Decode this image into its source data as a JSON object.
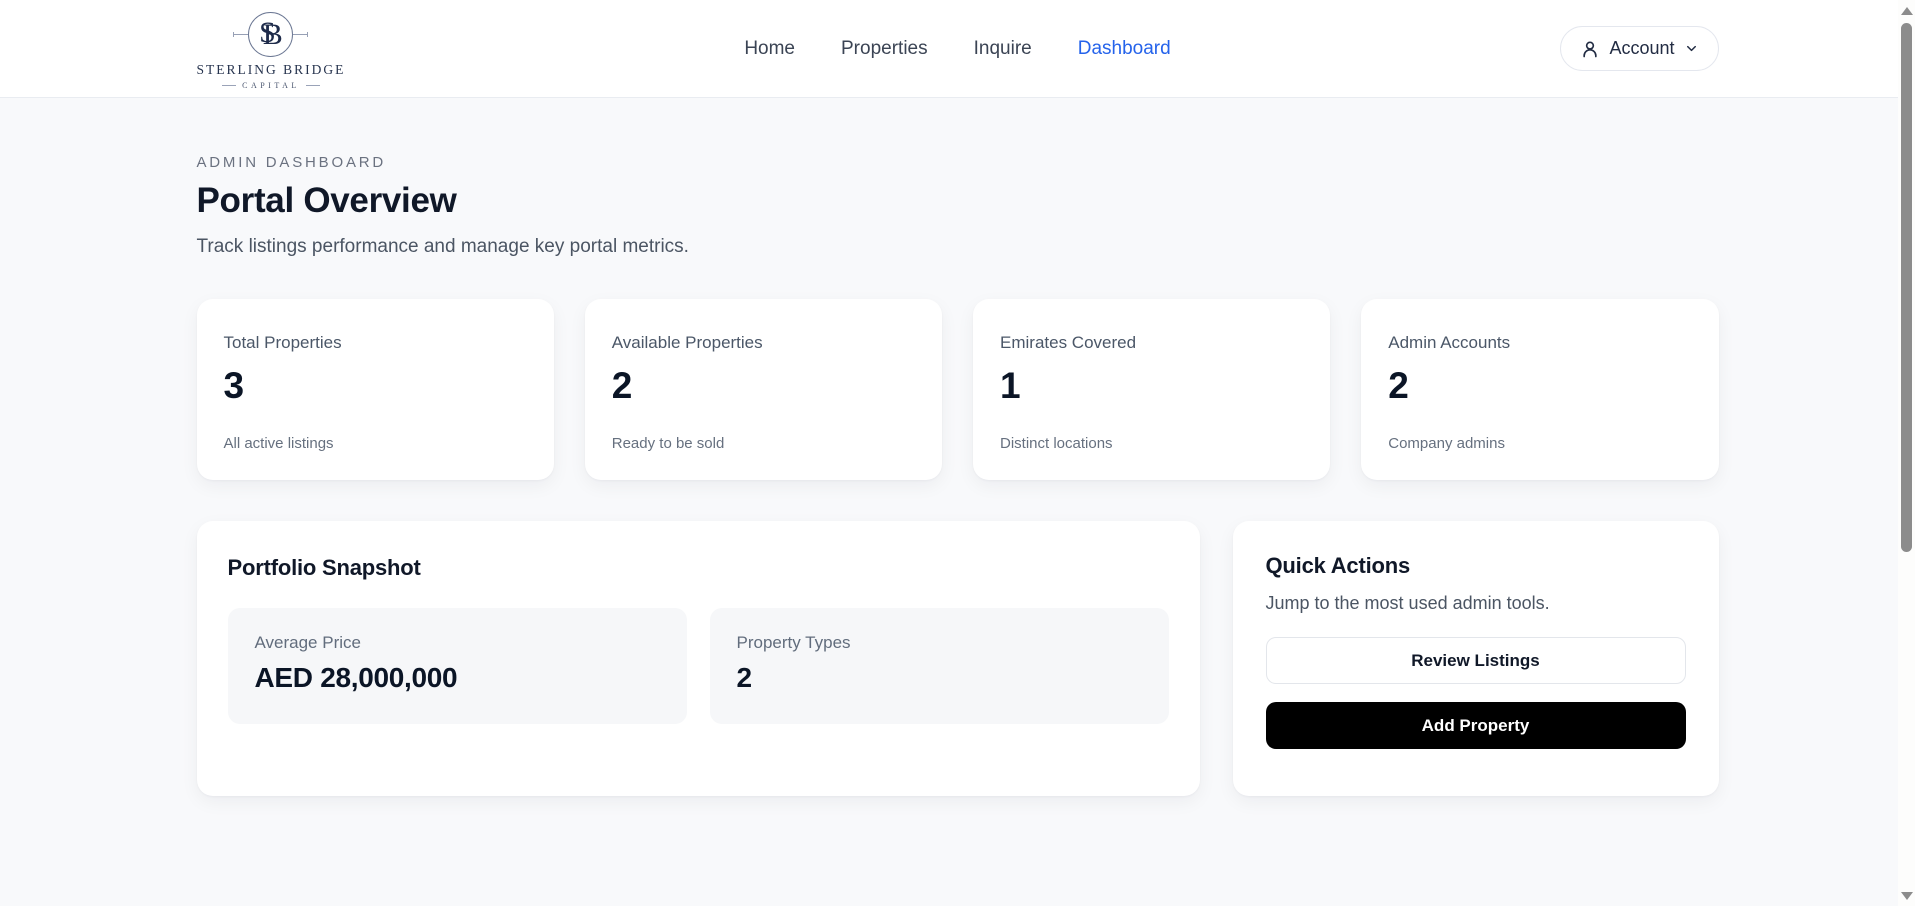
{
  "brand": {
    "monogram_left": "S",
    "monogram_right": "B",
    "name": "STERLING BRIDGE",
    "subtitle": "CAPITAL"
  },
  "nav": {
    "items": [
      {
        "label": "Home",
        "active": false
      },
      {
        "label": "Properties",
        "active": false
      },
      {
        "label": "Inquire",
        "active": false
      },
      {
        "label": "Dashboard",
        "active": true
      }
    ]
  },
  "account": {
    "label": "Account"
  },
  "page": {
    "eyebrow": "ADMIN DASHBOARD",
    "title": "Portal Overview",
    "subtitle": "Track listings performance and manage key portal metrics."
  },
  "stats": [
    {
      "label": "Total Properties",
      "value": "3",
      "note": "All active listings"
    },
    {
      "label": "Available Properties",
      "value": "2",
      "note": "Ready to be sold"
    },
    {
      "label": "Emirates Covered",
      "value": "1",
      "note": "Distinct locations"
    },
    {
      "label": "Admin Accounts",
      "value": "2",
      "note": "Company admins"
    }
  ],
  "portfolio": {
    "title": "Portfolio Snapshot",
    "tiles": [
      {
        "label": "Average Price",
        "value": "AED 28,000,000"
      },
      {
        "label": "Property Types",
        "value": "2"
      }
    ]
  },
  "quick_actions": {
    "title": "Quick Actions",
    "subtitle": "Jump to the most used admin tools.",
    "review_label": "Review Listings",
    "add_label": "Add Property"
  },
  "colors": {
    "accent_blue": "#2563eb",
    "brand_navy": "#1e2b4a",
    "page_bg": "#f8f9fb",
    "text_dark": "#0f172a",
    "text_muted": "#64748b",
    "button_black": "#000000"
  }
}
